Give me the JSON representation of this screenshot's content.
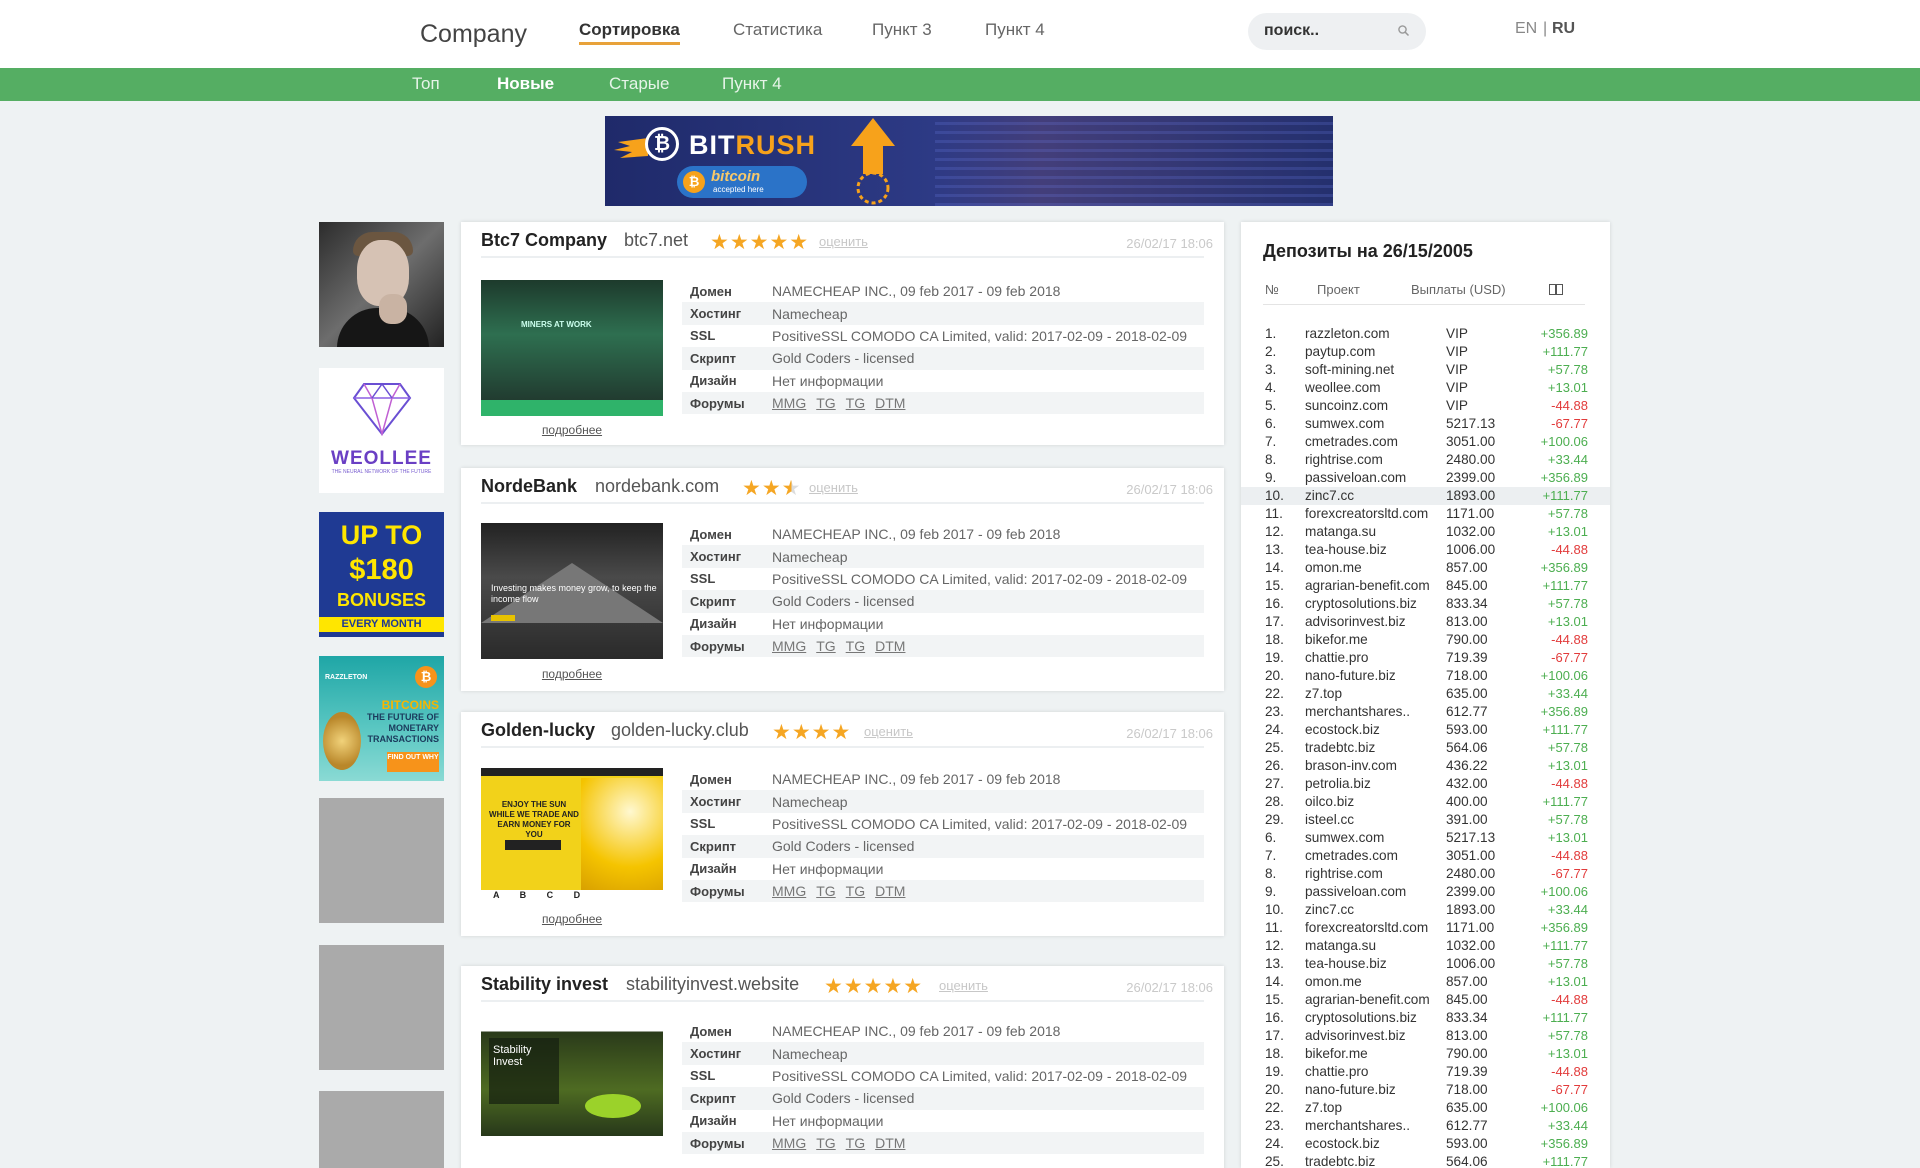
{
  "header": {
    "logo": "Company",
    "nav": [
      "Сортировка",
      "Статистика",
      "Пункт 3",
      "Пункт 4"
    ],
    "search_placeholder": "поиск..",
    "lang_en": "EN",
    "lang_sep": "|",
    "lang_ru": "RU"
  },
  "subnav": [
    "Топ",
    "Новые",
    "Старые",
    "Пункт 4"
  ],
  "banner": {
    "brand_a": "BIT",
    "brand_b": "RUSH",
    "pill_title": "bitcoin",
    "pill_sub": "accepted here"
  },
  "ads": {
    "weollee_name": "WEOLLEE",
    "weollee_tag": "THE NEURAL NETWORK OF THE FUTURE",
    "bonus_l1": "UP TO",
    "bonus_l2": "$180",
    "bonus_l3": "BONUSES",
    "bonus_l4": "EVERY MONTH",
    "razzle_logo": "RAZZLETON",
    "razzle_h": "BITCOINS",
    "razzle_sub": "THE FUTURE OF MONETARY TRANSACTIONS",
    "razzle_btn": "FIND OUT WHY"
  },
  "labels": {
    "domain": "Домен",
    "hosting": "Хостинг",
    "ssl": "SSL",
    "script": "Скрипт",
    "design": "Дизайн",
    "forums": "Форумы",
    "more": "подробнее",
    "rate": "оценить"
  },
  "projects": [
    {
      "name": "Btc7 Company",
      "url": "btc7.net",
      "rating": 5,
      "date": "26/02/17 18:06",
      "domain": "NAMECHEAP INC., 09 feb 2017 - 09 feb 2018",
      "hosting": "Namecheap",
      "ssl": "PositiveSSL COMODO CA Limited, valid: 2017-02-09 - 2018-02-09",
      "script": "Gold Coders - licensed",
      "design": "Нет информации",
      "forums": [
        "MMG",
        "TG",
        "TG",
        "DTM"
      ],
      "shot_text": "MINERS AT WORK"
    },
    {
      "name": "NordeBank",
      "url": "nordebank.com",
      "rating": 2.5,
      "date": "26/02/17 18:06",
      "domain": "NAMECHEAP INC., 09 feb 2017 - 09 feb 2018",
      "hosting": "Namecheap",
      "ssl": "PositiveSSL COMODO CA Limited, valid: 2017-02-09 - 2018-02-09",
      "script": "Gold Coders - licensed",
      "design": "Нет информации",
      "forums": [
        "MMG",
        "TG",
        "TG",
        "DTM"
      ],
      "shot_text": "Investing makes money grow, to keep the income flow"
    },
    {
      "name": "Golden-lucky",
      "url": "golden-lucky.club",
      "rating": 4,
      "date": "26/02/17 18:06",
      "domain": "NAMECHEAP INC., 09 feb 2017 - 09 feb 2018",
      "hosting": "Namecheap",
      "ssl": "PositiveSSL COMODO CA Limited, valid: 2017-02-09 - 2018-02-09",
      "script": "Gold Coders - licensed",
      "design": "Нет информации",
      "forums": [
        "MMG",
        "TG",
        "TG",
        "DTM"
      ],
      "shot_text": "ENJOY THE SUN WHILE WE TRADE AND EARN MONEY FOR YOU",
      "shot_foot": "A  B  C  D"
    },
    {
      "name": "Stability invest",
      "url": "stabilityinvest.website",
      "rating": 5,
      "date": "26/02/17 18:06",
      "domain": "NAMECHEAP INC., 09 feb 2017 - 09 feb 2018",
      "hosting": "Namecheap",
      "ssl": "PositiveSSL COMODO CA Limited, valid: 2017-02-09 - 2018-02-09",
      "script": "Gold Coders - licensed",
      "design": "Нет информации",
      "forums": [
        "MMG",
        "TG",
        "TG",
        "DTM"
      ],
      "shot_text": "Stability Invest"
    }
  ],
  "deposits": {
    "title": "Депозиты на 26/15/2005",
    "col_num": "№",
    "col_project": "Проект",
    "col_payout": "Выплаты (USD)",
    "rows": [
      [
        "1.",
        "razzleton.com",
        "VIP",
        "+356.89"
      ],
      [
        "2.",
        "paytup.com",
        "VIP",
        "+111.77"
      ],
      [
        "3.",
        "soft-mining.net",
        "VIP",
        "+57.78"
      ],
      [
        "4.",
        "weollee.com",
        "VIP",
        "+13.01"
      ],
      [
        "5.",
        "suncoinz.com",
        "VIP",
        "-44.88"
      ],
      [
        "6.",
        "sumwex.com",
        "5217.13",
        "-67.77"
      ],
      [
        "7.",
        "cmetrades.com",
        "3051.00",
        "+100.06"
      ],
      [
        "8.",
        "rightrise.com",
        "2480.00",
        "+33.44"
      ],
      [
        "9.",
        "passiveloan.com",
        "2399.00",
        "+356.89"
      ],
      [
        "10.",
        "zinc7.cc",
        "1893.00",
        "+111.77"
      ],
      [
        "11.",
        "forexcreatorsltd.com",
        "1171.00",
        "+57.78"
      ],
      [
        "12.",
        "matanga.su",
        "1032.00",
        "+13.01"
      ],
      [
        "13.",
        "tea-house.biz",
        "1006.00",
        "-44.88"
      ],
      [
        "14.",
        "omon.me",
        "857.00",
        "+356.89"
      ],
      [
        "15.",
        "agrarian-benefit.com",
        "845.00",
        "+111.77"
      ],
      [
        "16.",
        "cryptosolutions.biz",
        "833.34",
        "+57.78"
      ],
      [
        "17.",
        "advisorinvest.biz",
        "813.00",
        "+13.01"
      ],
      [
        "18.",
        "bikefor.me",
        "790.00",
        "-44.88"
      ],
      [
        "19.",
        "chattie.pro",
        "719.39",
        "-67.77"
      ],
      [
        "20.",
        "nano-future.biz",
        "718.00",
        "+100.06"
      ],
      [
        "22.",
        "z7.top",
        "635.00",
        "+33.44"
      ],
      [
        "23.",
        "merchantshares..",
        "612.77",
        "+356.89"
      ],
      [
        "24.",
        "ecostock.biz",
        "593.00",
        "+111.77"
      ],
      [
        "25.",
        "tradebtc.biz",
        "564.06",
        "+57.78"
      ],
      [
        "26.",
        "brason-inv.com",
        "436.22",
        "+13.01"
      ],
      [
        "27.",
        "petrolia.biz",
        "432.00",
        "-44.88"
      ],
      [
        "28.",
        "oilco.biz",
        "400.00",
        "+111.77"
      ],
      [
        "29.",
        "isteel.cc",
        "391.00",
        "+57.78"
      ],
      [
        "6.",
        "sumwex.com",
        "5217.13",
        "+13.01"
      ],
      [
        "7.",
        "cmetrades.com",
        "3051.00",
        "-44.88"
      ],
      [
        "8.",
        "rightrise.com",
        "2480.00",
        "-67.77"
      ],
      [
        "9.",
        "passiveloan.com",
        "2399.00",
        "+100.06"
      ],
      [
        "10.",
        "zinc7.cc",
        "1893.00",
        "+33.44"
      ],
      [
        "11.",
        "forexcreatorsltd.com",
        "1171.00",
        "+356.89"
      ],
      [
        "12.",
        "matanga.su",
        "1032.00",
        "+111.77"
      ],
      [
        "13.",
        "tea-house.biz",
        "1006.00",
        "+57.78"
      ],
      [
        "14.",
        "omon.me",
        "857.00",
        "+13.01"
      ],
      [
        "15.",
        "agrarian-benefit.com",
        "845.00",
        "-44.88"
      ],
      [
        "16.",
        "cryptosolutions.biz",
        "833.34",
        "+111.77"
      ],
      [
        "17.",
        "advisorinvest.biz",
        "813.00",
        "+57.78"
      ],
      [
        "18.",
        "bikefor.me",
        "790.00",
        "+13.01"
      ],
      [
        "19.",
        "chattie.pro",
        "719.39",
        "-44.88"
      ],
      [
        "20.",
        "nano-future.biz",
        "718.00",
        "-67.77"
      ],
      [
        "22.",
        "z7.top",
        "635.00",
        "+100.06"
      ],
      [
        "23.",
        "merchantshares..",
        "612.77",
        "+33.44"
      ],
      [
        "24.",
        "ecostock.biz",
        "593.00",
        "+356.89"
      ],
      [
        "25.",
        "tradebtc.biz",
        "564.06",
        "+111.77"
      ]
    ]
  }
}
